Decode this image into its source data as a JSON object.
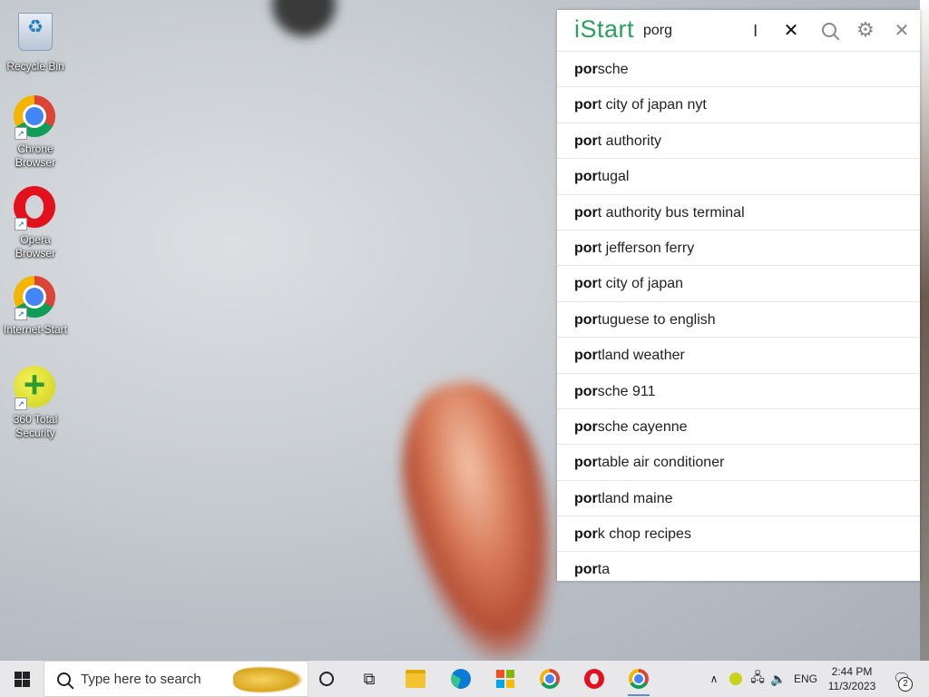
{
  "desktop": {
    "icons": [
      {
        "label": "Recycle Bin",
        "icon": "recycle-bin-icon"
      },
      {
        "label": "Chrone Browser",
        "icon": "chrome-icon"
      },
      {
        "label": "Opera Browser",
        "icon": "opera-icon"
      },
      {
        "label": "Internet-Start",
        "icon": "chrome-icon"
      },
      {
        "label": "360 Total Security",
        "icon": "360-security-icon"
      }
    ]
  },
  "istart": {
    "logo": "iStart",
    "query": "porg",
    "clear_icon": "✕",
    "gear_icon": "⚙",
    "close_icon": "✕",
    "suggestions": [
      {
        "bold": "por",
        "rest": "sche"
      },
      {
        "bold": "por",
        "rest": "t city of japan nyt"
      },
      {
        "bold": "por",
        "rest": "t authority"
      },
      {
        "bold": "por",
        "rest": "tugal"
      },
      {
        "bold": "por",
        "rest": "t authority bus terminal"
      },
      {
        "bold": "por",
        "rest": "t jefferson ferry"
      },
      {
        "bold": "por",
        "rest": "t city of japan"
      },
      {
        "bold": "por",
        "rest": "tuguese to english"
      },
      {
        "bold": "por",
        "rest": "tland weather"
      },
      {
        "bold": "por",
        "rest": "sche 911"
      },
      {
        "bold": "por",
        "rest": "sche cayenne"
      },
      {
        "bold": "por",
        "rest": "table air conditioner"
      },
      {
        "bold": "por",
        "rest": "tland maine"
      },
      {
        "bold": "por",
        "rest": "k chop recipes"
      },
      {
        "bold": "por",
        "rest": "ta"
      }
    ]
  },
  "taskbar": {
    "search_placeholder": "Type here to search",
    "taskview_glyph": "⧉",
    "tray_chevron": "∧",
    "net_glyph": "🖧",
    "vol_glyph": "🔈",
    "language": "ENG",
    "time": "2:44 PM",
    "date": "11/3/2023",
    "notification_glyph": "🗨",
    "notification_count": "2"
  }
}
